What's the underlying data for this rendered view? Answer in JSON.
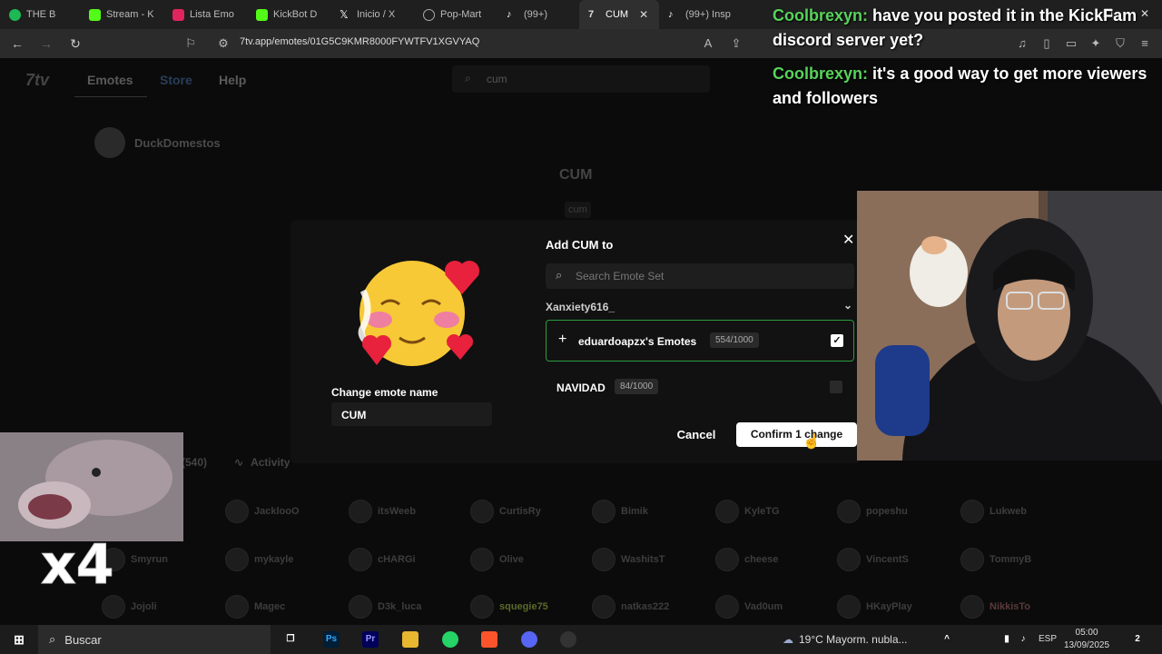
{
  "browser": {
    "tabs": [
      {
        "label": "THE B",
        "color": "#1db954"
      },
      {
        "label": "Stream - K",
        "color": "#53fc18"
      },
      {
        "label": "Lista Emo",
        "color": "#e0245e"
      },
      {
        "label": "KickBot D",
        "color": "#53fc18"
      },
      {
        "label": "Inicio / X",
        "color": "#ffffff"
      },
      {
        "label": "Pop-Mart",
        "color": "#888888"
      },
      {
        "label": "(99+)",
        "color": "#111111"
      },
      {
        "label": "CUM",
        "color": "#dddddd"
      },
      {
        "label": "(99+) Insp",
        "color": "#111111"
      }
    ],
    "url": "7tv.app/emotes/01G5C9KMR8000FYWTFV1XGVYAQ"
  },
  "site": {
    "logo": "7tv",
    "nav": [
      "Emotes",
      "Store",
      "Help"
    ],
    "search_value": "cum",
    "owner": "DuckDomestos",
    "emote_title": "CUM",
    "emote_sub": "cum",
    "tab_count": "(540)",
    "tab_activity": "Activity",
    "users": [
      "JacklooO",
      "itsWeeb",
      "CurtisRy",
      "Bimik",
      "KyleTG",
      "popeshu",
      "Lukweb",
      "Smyrun",
      "mykayle",
      "cHARGi",
      "Olive",
      "WashitsT",
      "cheese",
      "VincentS",
      "TommyB",
      "Jojoli",
      "Magec",
      "D3k_luca",
      "squegie75",
      "natkas222",
      "Vad0um",
      "HKayPlay",
      "NikkisTo"
    ]
  },
  "modal": {
    "title": "Add CUM to",
    "search_placeholder": "Search Emote Set",
    "user": "Xanxiety616_",
    "sets": [
      {
        "name": "eduardoapzx's Emotes",
        "count": "554/1000",
        "checked": true
      },
      {
        "name": "NAVIDAD",
        "count": "84/1000",
        "checked": false
      }
    ],
    "change_name_label": "Change emote name",
    "name_value": "CUM",
    "cancel": "Cancel",
    "confirm": "Confirm 1 change"
  },
  "chat": [
    {
      "user": "Coolbrexyn:",
      "text": "have you posted it in the KickFam discord server yet?"
    },
    {
      "user": "Coolbrexyn:",
      "text": "it's a good way to get more viewers and followers"
    }
  ],
  "overlay": {
    "fish_text": "x4"
  },
  "taskbar": {
    "search": "Buscar",
    "weather": "19°C  Mayorm. nubla...",
    "lang": "ESP",
    "time": "05:00",
    "date": "13/09/2025",
    "notif": "2"
  }
}
